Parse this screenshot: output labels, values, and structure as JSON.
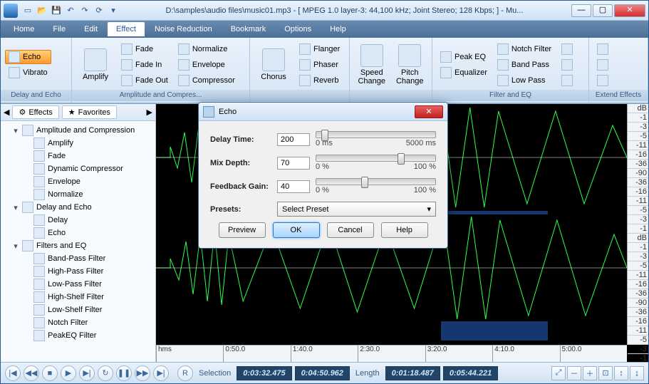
{
  "title": "D:\\samples\\audio files\\music01.mp3 - [ MPEG 1.0 layer-3: 44,100 kHz; Joint Stereo; 128 Kbps;  ] - Mu...",
  "menu": [
    "Home",
    "File",
    "Edit",
    "Effect",
    "Noise Reduction",
    "Bookmark",
    "Options",
    "Help"
  ],
  "active_menu": "Effect",
  "ribbon": {
    "g1": {
      "label": "Delay and Echo",
      "echo": "Echo",
      "vibrato": "Vibrato"
    },
    "g2": {
      "label": "Amplitude and Compres...",
      "amplify": "Amplify",
      "fade": "Fade",
      "fadein": "Fade In",
      "fadeout": "Fade Out",
      "normalize": "Normalize",
      "envelope": "Envelope",
      "compressor": "Compressor"
    },
    "g3": {
      "label": "",
      "chorus": "Chorus",
      "flanger": "Flanger",
      "phaser": "Phaser",
      "reverb": "Reverb"
    },
    "g4": {
      "label": "",
      "speed": "Speed\nChange",
      "pitch": "Pitch\nChange"
    },
    "g5": {
      "label": "Filter and EQ",
      "peakeq": "Peak EQ",
      "equalizer": "Equalizer",
      "notch": "Notch Filter",
      "bandpass": "Band Pass",
      "lowpass": "Low Pass"
    },
    "g6": {
      "label": "Extend Effects"
    }
  },
  "side_tabs": {
    "effects": "Effects",
    "favorites": "Favorites"
  },
  "tree": [
    {
      "l": 1,
      "exp": "▾",
      "t": "Amplitude and Compression"
    },
    {
      "l": 2,
      "t": "Amplify"
    },
    {
      "l": 2,
      "t": "Fade"
    },
    {
      "l": 2,
      "t": "Dynamic Compressor"
    },
    {
      "l": 2,
      "t": "Envelope"
    },
    {
      "l": 2,
      "t": "Normalize"
    },
    {
      "l": 1,
      "exp": "▾",
      "t": "Delay and Echo"
    },
    {
      "l": 2,
      "t": "Delay"
    },
    {
      "l": 2,
      "t": "Echo"
    },
    {
      "l": 1,
      "exp": "▾",
      "t": "Filters and EQ"
    },
    {
      "l": 2,
      "t": "Band-Pass Filter"
    },
    {
      "l": 2,
      "t": "High-Pass Filter"
    },
    {
      "l": 2,
      "t": "Low-Pass Filter"
    },
    {
      "l": 2,
      "t": "High-Shelf Filter"
    },
    {
      "l": 2,
      "t": "Low-Shelf Filter"
    },
    {
      "l": 2,
      "t": "Notch Filter"
    },
    {
      "l": 2,
      "t": "PeakEQ Filter"
    }
  ],
  "ruler": [
    "hms",
    "0:50.0",
    "1:40.0",
    "2:30.0",
    "3:20.0",
    "4:10.0",
    "5:00.0"
  ],
  "db": [
    "dB",
    "-1",
    "-3",
    "-5",
    "-11",
    "-16",
    "-36",
    "-90",
    "-36",
    "-16",
    "-11",
    "-5",
    "-3",
    "-1"
  ],
  "status": {
    "selection": "Selection",
    "sel_start": "0:03:32.475",
    "sel_end": "0:04:50.962",
    "length": "Length",
    "len1": "0:01:18.487",
    "len2": "0:05:44.221",
    "rec": "R"
  },
  "dialog": {
    "title": "Echo",
    "delay_label": "Delay Time:",
    "delay_val": "200",
    "delay_min": "0 ms",
    "delay_max": "5000 ms",
    "mix_label": "Mix Depth:",
    "mix_val": "70",
    "mix_min": "0 %",
    "mix_max": "100 %",
    "fb_label": "Feedback Gain:",
    "fb_val": "40",
    "fb_min": "0 %",
    "fb_max": "100 %",
    "presets_label": "Presets:",
    "preset_sel": "Select Preset",
    "preview": "Preview",
    "ok": "OK",
    "cancel": "Cancel",
    "help": "Help"
  }
}
